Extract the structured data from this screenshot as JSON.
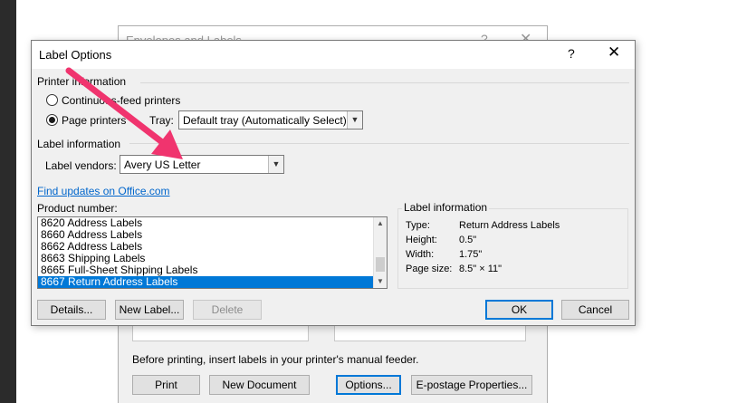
{
  "background_dialog": {
    "title": "Envelopes and Labels",
    "help_glyph": "?",
    "close_glyph": "✕",
    "feed_text": "Before printing, insert labels in your printer's manual feeder.",
    "buttons": {
      "print": "Print",
      "new_document": "New Document",
      "options": "Options...",
      "epostage": "E-postage Properties..."
    }
  },
  "dialog": {
    "title": "Label Options",
    "help_glyph": "?",
    "close_glyph": "✕",
    "printer_information": {
      "heading": "Printer information",
      "continuous_feed_label": "Continuous-feed printers",
      "page_printers_label": "Page printers",
      "selected": "page_printers",
      "tray_label": "Tray:",
      "tray_value": "Default tray (Automatically Select)"
    },
    "label_information": {
      "heading": "Label information",
      "vendors_label": "Label vendors:",
      "vendors_value": "Avery US Letter"
    },
    "find_updates_link": "Find updates on Office.com",
    "product_number": {
      "label": "Product number:",
      "items": [
        "8620 Address Labels",
        "8660 Address Labels",
        "8662 Address Labels",
        "8663 Shipping Labels",
        "8665 Full-Sheet Shipping Labels",
        "8667 Return Address Labels"
      ],
      "selected_index": 5
    },
    "label_details": {
      "heading": "Label information",
      "type_key": "Type:",
      "type_value": "Return Address Labels",
      "height_key": "Height:",
      "height_value": "0.5\"",
      "width_key": "Width:",
      "width_value": "1.75\"",
      "page_size_key": "Page size:",
      "page_size_value": "8.5\" × 11\""
    },
    "buttons": {
      "details": "Details...",
      "new_label": "New Label...",
      "delete": "Delete",
      "ok": "OK",
      "cancel": "Cancel"
    }
  },
  "colors": {
    "accent": "#0078d7",
    "link": "#0066cc",
    "annotation_arrow": "#f0346e",
    "dialog_bg": "#f0f0f0"
  }
}
